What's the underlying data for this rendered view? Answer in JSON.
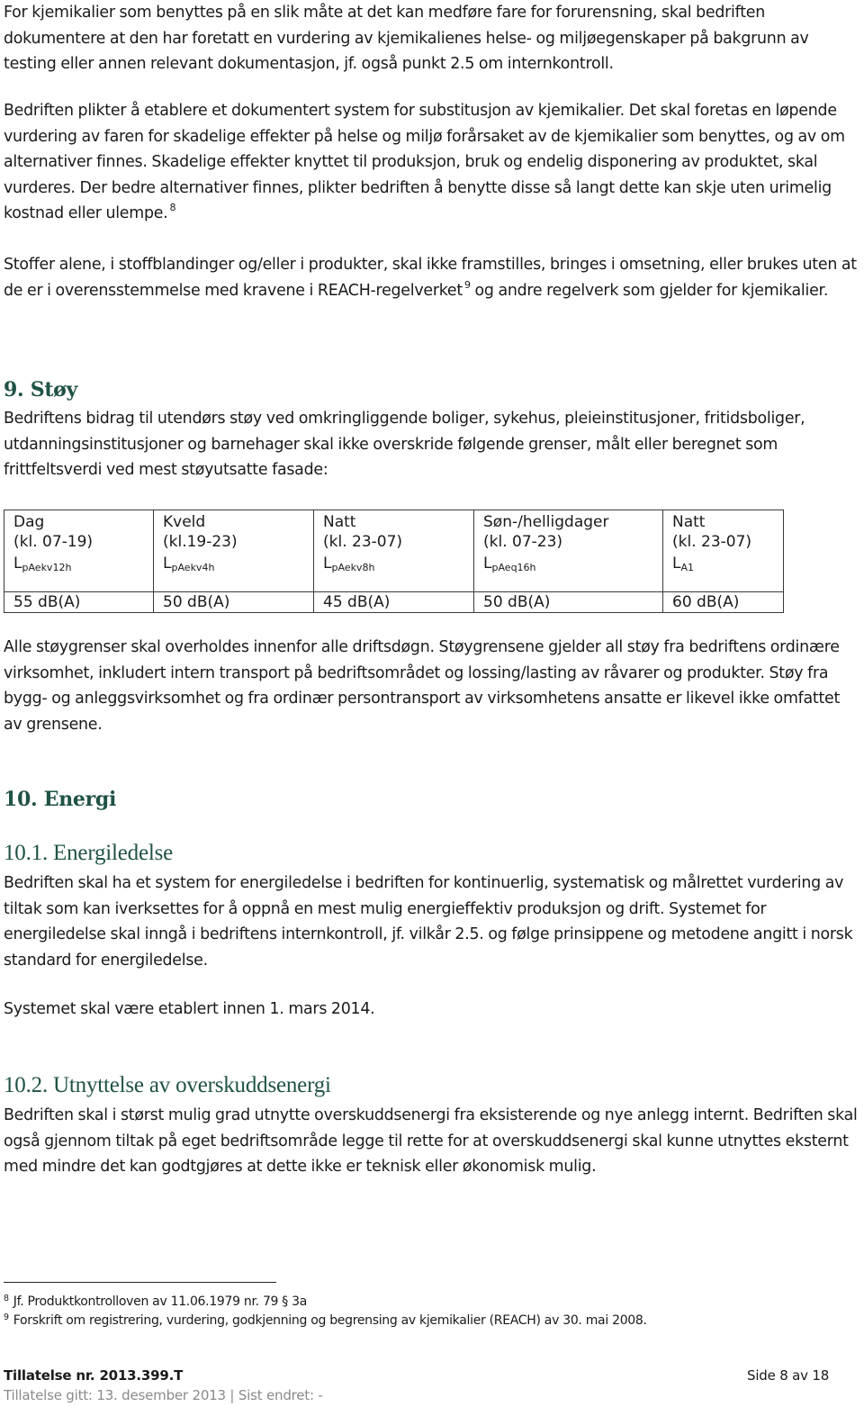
{
  "paragraphs": {
    "p1": "For kjemikalier som benyttes på en slik måte at det kan medføre fare for forurensning, skal bedriften dokumentere at den har foretatt en vurdering av kjemikalienes helse- og miljøegenskaper på bakgrunn av testing eller annen relevant dokumentasjon, jf. også punkt 2.5 om internkontroll.",
    "p2": "Bedriften plikter å etablere et dokumentert system for substitusjon av kjemikalier. Det skal foretas en løpende vurdering av faren for skadelige effekter på helse og miljø forårsaket av de kjemikalier som benyttes, og av om alternativer finnes. Skadelige effekter knyttet til produksjon, bruk og endelig disponering av produktet, skal vurderes. Der bedre alternativer finnes, plikter bedriften å benytte disse så langt dette kan skje uten urimelig kostnad eller ulempe.",
    "p2_footnote_ref": "8",
    "p3_before": "Stoffer alene, i stoffblandinger og/eller i produkter, skal ikke framstilles, bringes i omsetning, eller brukes uten at de er i overensstemmelse med kravene i REACH-regelverket",
    "p3_footnote_ref": "9",
    "p3_after": " og andre regelverk som gjelder for kjemikalier."
  },
  "section9": {
    "heading": "9. Støy",
    "intro": "Bedriftens bidrag til utendørs støy ved omkringliggende boliger, sykehus, pleieinstitusjoner, fritidsboliger, utdanningsinstitusjoner og barnehager skal ikke overskride følgende grenser, målt eller beregnet som frittfeltsverdi ved mest støyutsatte fasade:",
    "table": {
      "columns": [
        {
          "period": "Dag",
          "hours": "(kl. 07-19)",
          "symbol": "L",
          "subscript": "pAekv12h",
          "value": "55 dB(A)"
        },
        {
          "period": "Kveld",
          "hours": "(kl.19-23)",
          "symbol": "L",
          "subscript": "pAekv4h",
          "value": "50 dB(A)"
        },
        {
          "period": "Natt",
          "hours": "(kl. 23-07)",
          "symbol": "L",
          "subscript": "pAekv8h",
          "value": "45 dB(A)"
        },
        {
          "period": "Søn-/helligdager",
          "hours": "(kl. 07-23)",
          "symbol": "L",
          "subscript": "pAeq16h",
          "value": "50 dB(A)"
        },
        {
          "period": "Natt",
          "hours": "(kl. 23-07)",
          "symbol": "L",
          "subscript": "A1",
          "value": "60 dB(A)"
        }
      ]
    },
    "after": "Alle støygrenser skal overholdes innenfor alle driftsdøgn. Støygrensene gjelder all støy fra bedriftens ordinære virksomhet, inkludert intern transport på bedriftsområdet og lossing/lasting av råvarer og produkter. Støy fra bygg- og anleggsvirksomhet og fra ordinær persontransport av virksomhetens ansatte er likevel ikke omfattet av grensene."
  },
  "section10": {
    "heading": "10. Energi",
    "sub1": {
      "heading": "10.1. Energiledelse",
      "text": "Bedriften skal ha et system for energiledelse i bedriften for kontinuerlig, systematisk og målrettet vurdering av tiltak som kan iverksettes for å oppnå en mest mulig energieffektiv produksjon og drift. Systemet for energiledelse skal inngå i bedriftens internkontroll, jf. vilkår 2.5. og følge prinsippene og metodene angitt i norsk standard for energiledelse.",
      "deadline": "Systemet skal være etablert innen 1. mars 2014."
    },
    "sub2": {
      "heading": "10.2. Utnyttelse av overskuddsenergi",
      "text": "Bedriften skal i størst mulig grad utnytte overskuddsenergi fra eksisterende og nye anlegg internt. Bedriften skal også gjennom tiltak på eget bedriftsområde legge til rette for at overskuddsenergi skal kunne utnyttes eksternt med mindre det kan godtgjøres at dette ikke er teknisk eller økonomisk mulig."
    }
  },
  "footnotes": [
    {
      "num": "8",
      "text": "Jf. Produktkontrolloven av 11.06.1979 nr. 79 § 3a"
    },
    {
      "num": "9",
      "text": "Forskrift om registrering, vurdering, godkjenning og begrensing av kjemikalier (REACH) av 30. mai 2008."
    }
  ],
  "footer": {
    "permit": "Tillatelse nr. 2013.399.T",
    "page": "Side 8 av 18",
    "issued": "Tillatelse gitt: 13. desember 2013 | Sist endret: -"
  },
  "colors": {
    "heading": "#1f5246",
    "text": "#1a1a1a",
    "footer_sub": "#8a8a8a"
  }
}
